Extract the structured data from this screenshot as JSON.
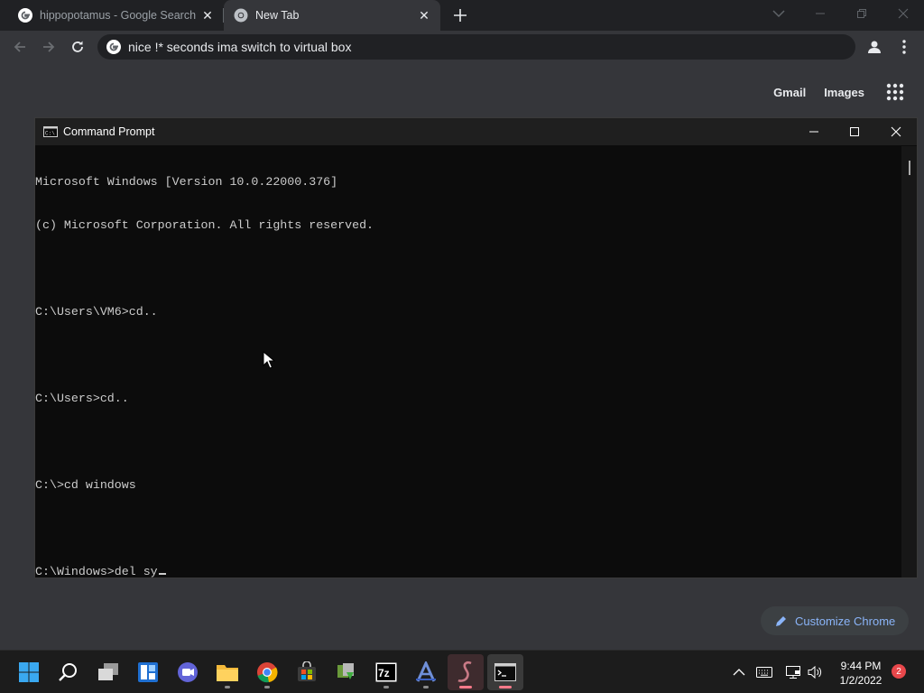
{
  "browser": {
    "tabs": [
      {
        "title": "hippopotamus - Google Search",
        "icon": "google-icon",
        "active": false
      },
      {
        "title": "New Tab",
        "icon": "chrome-icon",
        "active": true
      }
    ],
    "omnibox": {
      "text": "nice !* seconds ima switch to virtual box",
      "icon": "google-icon"
    },
    "ntp_links": {
      "gmail": "Gmail",
      "images": "Images"
    },
    "customize_label": "Customize Chrome"
  },
  "cmd": {
    "title": "Command Prompt",
    "lines": [
      "Microsoft Windows [Version 10.0.22000.376]",
      "(c) Microsoft Corporation. All rights reserved.",
      "",
      "C:\\Users\\VM6>cd..",
      "",
      "C:\\Users>cd..",
      "",
      "C:\\>cd windows",
      "",
      "C:\\Windows>del sy"
    ]
  },
  "taskbar": {
    "apps": [
      "start",
      "search",
      "task-view",
      "widgets",
      "teams-chat",
      "file-explorer",
      "chrome",
      "microsoft-store",
      "archive-tool",
      "7zip",
      "app-a",
      "app-s",
      "command-prompt"
    ],
    "clock": {
      "time": "9:44 PM",
      "date": "1/2/2022"
    },
    "notification_count": "2"
  },
  "colors": {
    "chrome_frame": "#202124",
    "chrome_toolbar": "#35363a",
    "cmd_background": "#0c0c0c",
    "cmd_text": "#cccccc",
    "accent_link": "#8ab4f8",
    "taskbar": "#1c1c1c"
  }
}
